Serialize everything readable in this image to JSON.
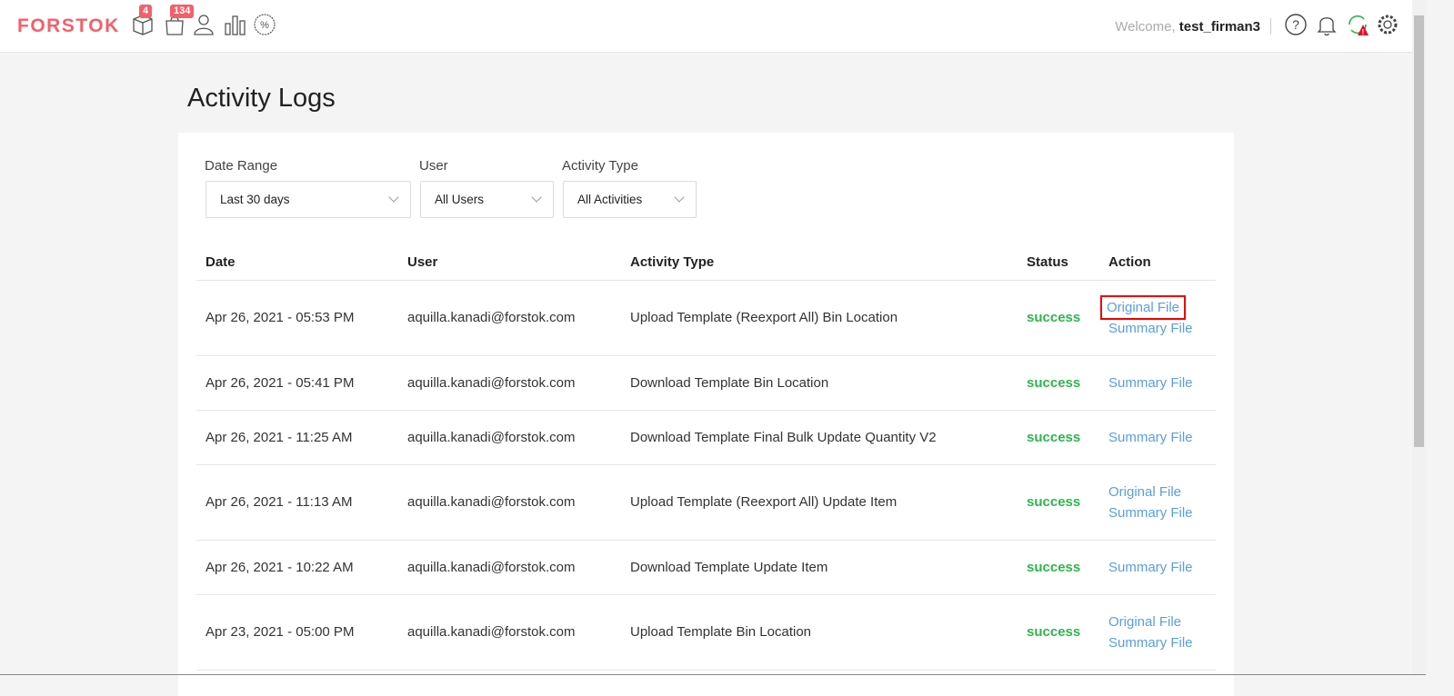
{
  "header": {
    "logo": "FORSTOK",
    "badges": {
      "products": "4",
      "orders": "134"
    },
    "welcome": "Welcome,",
    "username": "test_firman3",
    "icons": [
      "box-icon",
      "shopping-bag-icon",
      "user-icon",
      "bar-chart-icon",
      "promo-percent-icon",
      "help-icon",
      "bell-icon",
      "sync-warning-icon",
      "gear-icon"
    ]
  },
  "page": {
    "title": "Activity Logs"
  },
  "filters": {
    "date_range": {
      "label": "Date Range",
      "value": "Last 30 days"
    },
    "user": {
      "label": "User",
      "value": "All Users"
    },
    "activity_type": {
      "label": "Activity Type",
      "value": "All Activities"
    }
  },
  "table": {
    "headers": [
      "Date",
      "User",
      "Activity Type",
      "Status",
      "Action"
    ],
    "rows": [
      {
        "date": "Apr 26, 2021 - 05:53 PM",
        "user": "aquilla.kanadi@forstok.com",
        "activity": "Upload Template (Reexport All) Bin Location",
        "status": "success",
        "actions": [
          "Original File",
          "Summary File"
        ]
      },
      {
        "date": "Apr 26, 2021 - 05:41 PM",
        "user": "aquilla.kanadi@forstok.com",
        "activity": "Download Template Bin Location",
        "status": "success",
        "actions": [
          "Summary File"
        ]
      },
      {
        "date": "Apr 26, 2021 - 11:25 AM",
        "user": "aquilla.kanadi@forstok.com",
        "activity": "Download Template Final Bulk Update Quantity V2",
        "status": "success",
        "actions": [
          "Summary File"
        ]
      },
      {
        "date": "Apr 26, 2021 - 11:13 AM",
        "user": "aquilla.kanadi@forstok.com",
        "activity": "Upload Template (Reexport All) Update Item",
        "status": "success",
        "actions": [
          "Original File",
          "Summary File"
        ]
      },
      {
        "date": "Apr 26, 2021 - 10:22 AM",
        "user": "aquilla.kanadi@forstok.com",
        "activity": "Download Template Update Item",
        "status": "success",
        "actions": [
          "Summary File"
        ]
      },
      {
        "date": "Apr 23, 2021 - 05:00 PM",
        "user": "aquilla.kanadi@forstok.com",
        "activity": "Upload Template Bin Location",
        "status": "success",
        "actions": [
          "Original File",
          "Summary File"
        ]
      }
    ]
  },
  "colors": {
    "brand": "#f2606b",
    "success": "#2fb54d",
    "link": "#5a9ee0"
  }
}
